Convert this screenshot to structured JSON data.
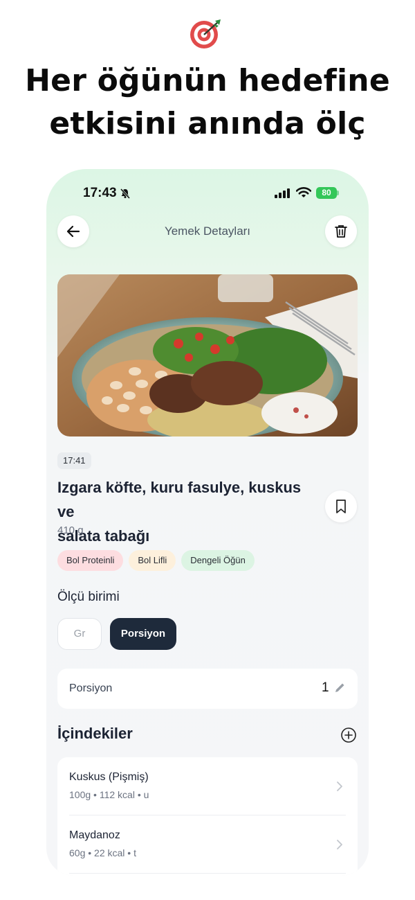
{
  "headline": {
    "line1": "Her öğünün hedefine",
    "line2": "etkisini anında ölç"
  },
  "status_bar": {
    "time": "17:43",
    "battery": "80"
  },
  "header": {
    "title": "Yemek Detayları"
  },
  "meal": {
    "logged_time": "17:41",
    "name_line1": "Izgara köfte, kuru fasulye, kuskus ve",
    "name_line2": "salata tabağı",
    "weight": "410 g",
    "tags": [
      {
        "label": "Bol Proteinli",
        "color": "#fddde0"
      },
      {
        "label": "Bol Lifli",
        "color": "#fdf0dc"
      },
      {
        "label": "Dengeli Öğün",
        "color": "#dcf4e3"
      }
    ]
  },
  "unit_selector": {
    "label": "Ölçü birimi",
    "options": [
      "Gr",
      "Porsiyon"
    ],
    "selected": "Porsiyon"
  },
  "portion": {
    "label": "Porsiyon",
    "value": "1"
  },
  "ingredients": {
    "title": "İçindekiler",
    "items": [
      {
        "name": "Kuskus (Pişmiş)",
        "meta": "100g • 112 kcal • u"
      },
      {
        "name": "Maydanoz",
        "meta": "60g • 22 kcal • t"
      }
    ]
  },
  "colors": {
    "accent_dark": "#1e2a3b",
    "battery": "#34c759",
    "target_red": "#e04848"
  }
}
